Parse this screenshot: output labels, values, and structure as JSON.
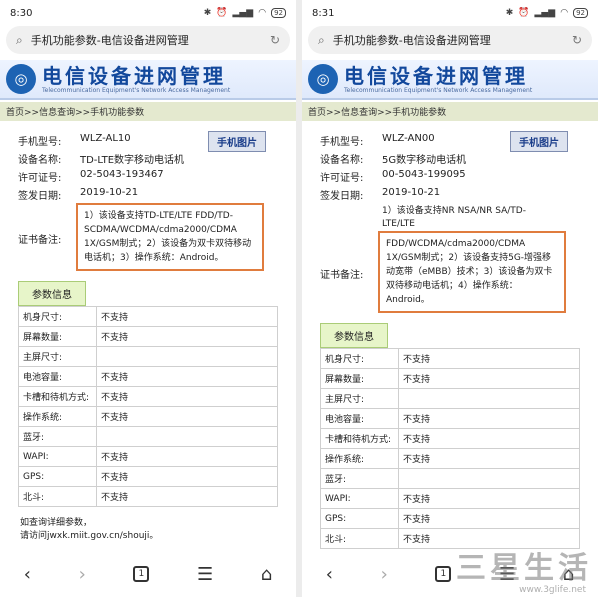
{
  "left": {
    "time": "8:30",
    "battery": "92",
    "url_title": "手机功能参数-电信设备进网管理",
    "banner_cn": "电信设备进网管理",
    "banner_en": "Telecommunication Equipment's Network Access Management",
    "breadcrumb": "首页>>信息查询>>手机功能参数",
    "model_label": "手机型号:",
    "model": "WLZ-AL10",
    "photo_btn": "手机图片",
    "device_label": "设备名称:",
    "device": "TD-LTE数字移动电话机",
    "license_label": "许可证号:",
    "license": "02-5043-193467",
    "date_label": "签发日期:",
    "date": "2019-10-21",
    "note_label": "证书备注:",
    "note": "1）该设备支持TD-LTE/LTE FDD/TD-SCDMA/WCDMA/cdma2000/CDMA 1X/GSM制式；2）该设备为双卡双待移动电话机；3）操作系统：Android。",
    "param_header": "参数信息",
    "params": [
      {
        "k": "机身尺寸:",
        "v": "不支持"
      },
      {
        "k": "屏幕数量:",
        "v": "不支持"
      },
      {
        "k": "主屏尺寸:",
        "v": ""
      },
      {
        "k": "电池容量:",
        "v": "不支持"
      },
      {
        "k": "卡槽和待机方式:",
        "v": "不支持"
      },
      {
        "k": "操作系统:",
        "v": "不支持"
      },
      {
        "k": "蓝牙:",
        "v": ""
      },
      {
        "k": "WAPI:",
        "v": "不支持"
      },
      {
        "k": "GPS:",
        "v": "不支持"
      },
      {
        "k": "北斗:",
        "v": "不支持"
      }
    ],
    "foot1": "如查询详细参数，",
    "foot2": "请访问jwxk.miit.gov.cn/shouji。",
    "tabs_count": "1"
  },
  "right": {
    "time": "8:31",
    "battery": "92",
    "url_title": "手机功能参数-电信设备进网管理",
    "banner_cn": "电信设备进网管理",
    "banner_en": "Telecommunication Equipment's Network Access Management",
    "breadcrumb": "首页>>信息查询>>手机功能参数",
    "model_label": "手机型号:",
    "model": "WLZ-AN00",
    "photo_btn": "手机图片",
    "device_label": "设备名称:",
    "device": "5G数字移动电话机",
    "license_label": "许可证号:",
    "license": "00-5043-199095",
    "date_label": "签发日期:",
    "date": "2019-10-21",
    "note_pre": "1）该设备支持NR NSA/NR SA/TD-LTE/LTE",
    "note_label": "证书备注:",
    "note": "FDD/WCDMA/cdma2000/CDMA 1X/GSM制式；2）该设备支持5G-增强移动宽带（eMBB）技术；3）该设备为双卡双待移动电话机；4）操作系统：Android。",
    "param_header": "参数信息",
    "params": [
      {
        "k": "机身尺寸:",
        "v": "不支持"
      },
      {
        "k": "屏幕数量:",
        "v": "不支持"
      },
      {
        "k": "主屏尺寸:",
        "v": ""
      },
      {
        "k": "电池容量:",
        "v": "不支持"
      },
      {
        "k": "卡槽和待机方式:",
        "v": "不支持"
      },
      {
        "k": "操作系统:",
        "v": "不支持"
      },
      {
        "k": "蓝牙:",
        "v": ""
      },
      {
        "k": "WAPI:",
        "v": "不支持"
      },
      {
        "k": "GPS:",
        "v": "不支持"
      },
      {
        "k": "北斗:",
        "v": "不支持"
      }
    ],
    "tabs_count": "1"
  },
  "watermark": "三星生活",
  "watermark_url": "www.3glife.net",
  "colors": {
    "highlight": "#e07c3e",
    "brand": "#12489c",
    "crumb_bg": "#e4e9cf"
  }
}
